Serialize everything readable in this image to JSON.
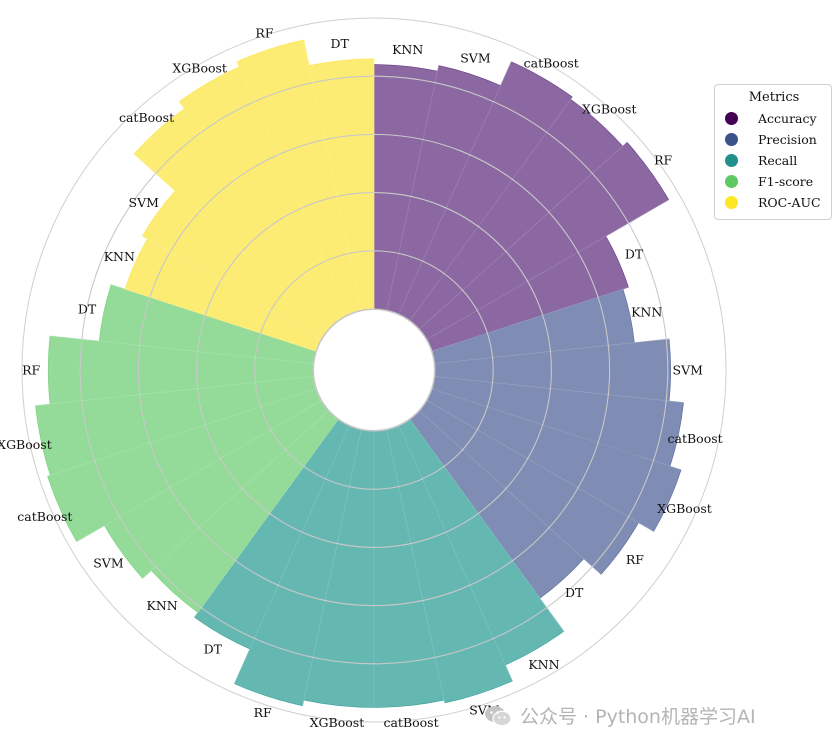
{
  "chart_data": {
    "type": "polar-bar",
    "title": "",
    "models": [
      "KNN",
      "SVM",
      "catBoost",
      "XGBoost",
      "RF",
      "DT"
    ],
    "series": [
      {
        "name": "Accuracy",
        "color": "#6a3d86",
        "values": [
          0.84,
          0.86,
          0.95,
          0.94,
          0.96,
          0.71
        ]
      },
      {
        "name": "Precision",
        "color": "#5b6c9e",
        "values": [
          0.69,
          0.81,
          0.86,
          0.9,
          0.84,
          0.76
        ]
      },
      {
        "name": "Recall",
        "color": "#3aa39c",
        "values": [
          0.9,
          0.96,
          0.95,
          0.95,
          0.97,
          0.84
        ]
      },
      {
        "name": "F1-score",
        "color": "#76d17c",
        "values": [
          0.82,
          0.86,
          0.97,
          0.96,
          0.91,
          0.74
        ]
      },
      {
        "name": "ROC-AUC",
        "color": "#fde74c",
        "values": [
          0.69,
          0.71,
          0.9,
          0.93,
          0.95,
          0.86
        ]
      }
    ],
    "radial_range": [
      0,
      1
    ],
    "grid": true,
    "legend": {
      "title": "Metrics",
      "placement": "top-right"
    }
  },
  "legend_colors": [
    "#440154",
    "#3b528b",
    "#21918c",
    "#5ec962",
    "#fde725"
  ],
  "watermark": {
    "text": "公众号 · Python机器学习AI",
    "icon": "wechat-icon"
  }
}
